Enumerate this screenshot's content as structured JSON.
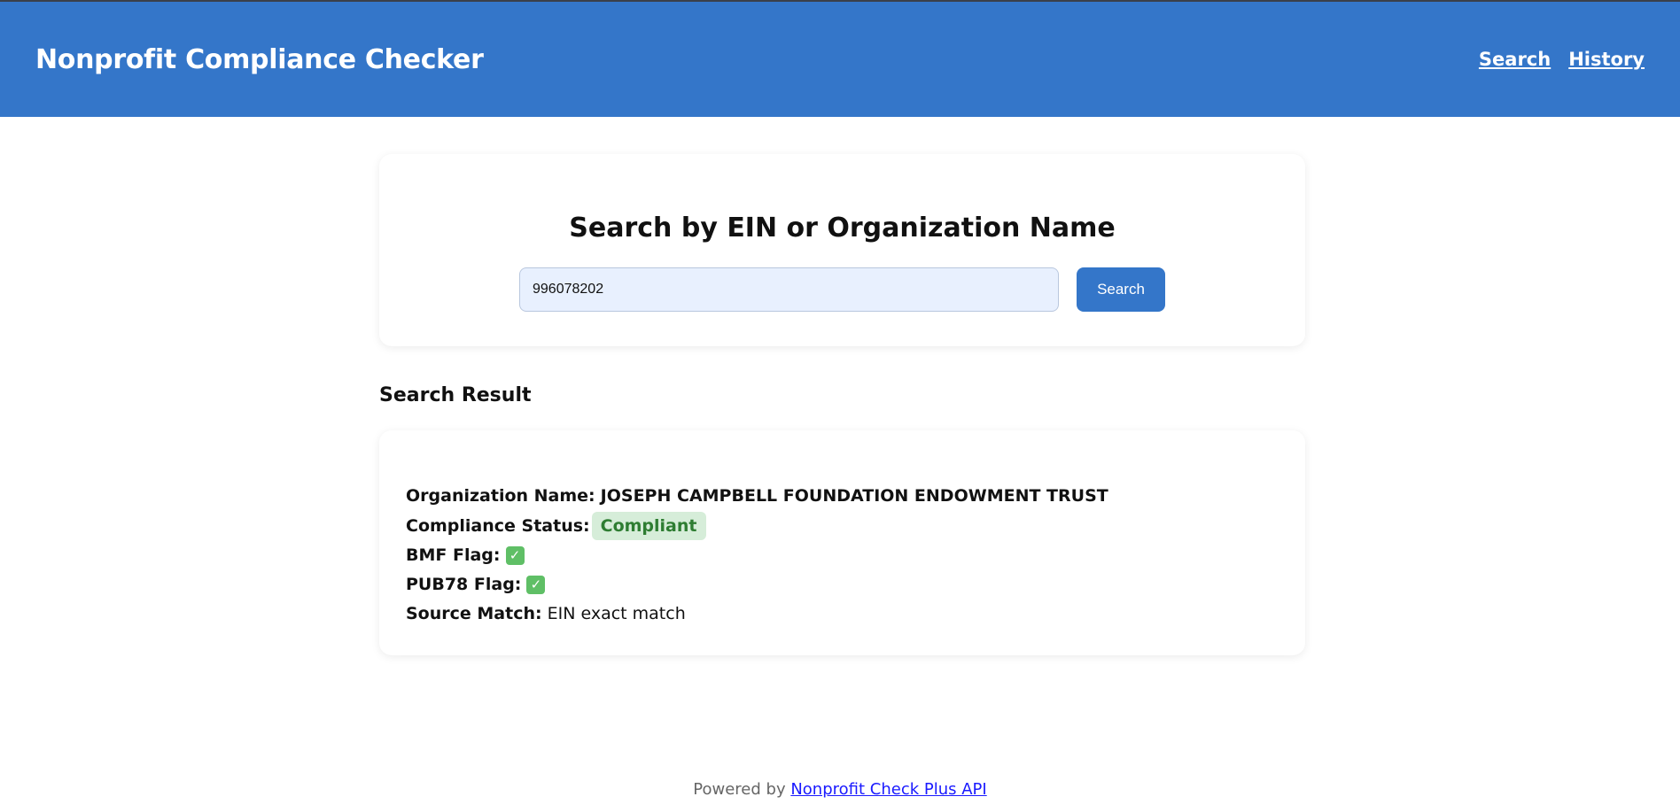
{
  "header": {
    "title": "Nonprofit Compliance Checker",
    "nav": [
      {
        "label": "Search"
      },
      {
        "label": "History"
      }
    ]
  },
  "search": {
    "title": "Search by EIN or Organization Name",
    "input_value": "996078202",
    "button_label": "Search"
  },
  "result": {
    "heading": "Search Result",
    "org_label": "Organization Name:",
    "org_value": "JOSEPH CAMPBELL FOUNDATION ENDOWMENT TRUST",
    "status_label": "Compliance Status:",
    "status_value": "Compliant",
    "bmf_label": "BMF Flag:",
    "bmf_icon": "check-mark-icon",
    "pub78_label": "PUB78 Flag:",
    "pub78_icon": "check-mark-icon",
    "source_label": "Source Match:",
    "source_value": "EIN exact match"
  },
  "footer": {
    "prefix": "Powered by",
    "link_text": "Nonprofit Check Plus API"
  },
  "colors": {
    "header_bg": "#3476c9",
    "button_bg": "#3476c9",
    "badge_bg": "#d6edd9",
    "badge_text": "#2e7d32",
    "check_bg": "#5fbf66"
  }
}
